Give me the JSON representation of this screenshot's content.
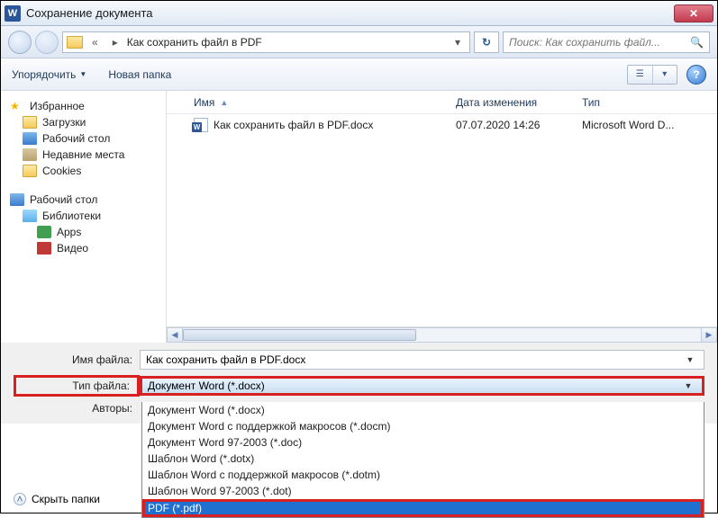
{
  "window": {
    "title": "Сохранение документа"
  },
  "nav": {
    "back_collapse": "«",
    "path_sep1": "▸",
    "path": "Как сохранить файл в PDF",
    "dropdown_glyph": "▾",
    "refresh_glyph": "↻",
    "search_placeholder": "Поиск: Как сохранить файл...",
    "search_icon_glyph": "🔍"
  },
  "toolbar": {
    "organize": "Упорядочить",
    "new_folder": "Новая папка",
    "view_glyph": "☰",
    "view_drop": "▾",
    "help_glyph": "?"
  },
  "sidebar": {
    "favorites": "Избранное",
    "downloads": "Загрузки",
    "desktop": "Рабочий стол",
    "recent": "Недавние места",
    "cookies": "Cookies",
    "desktop2": "Рабочий стол",
    "libraries": "Библиотеки",
    "apps": "Apps",
    "video": "Видео"
  },
  "columns": {
    "name": "Имя",
    "date": "Дата изменения",
    "type": "Тип"
  },
  "files": [
    {
      "name": "Как сохранить файл в PDF.docx",
      "date": "07.07.2020 14:26",
      "type": "Microsoft Word D..."
    }
  ],
  "form": {
    "filename_label": "Имя файла:",
    "filename_value": "Как сохранить файл в PDF.docx",
    "filetype_label": "Тип файла:",
    "filetype_value": "Документ Word (*.docx)",
    "authors_label": "Авторы:"
  },
  "dropdown": {
    "items": [
      "Документ Word (*.docx)",
      "Документ Word с поддержкой макросов (*.docm)",
      "Документ Word 97-2003 (*.doc)",
      "Шаблон Word (*.dotx)",
      "Шаблон Word с поддержкой макросов (*.dotm)",
      "Шаблон Word 97-2003 (*.dot)",
      "PDF (*.pdf)"
    ]
  },
  "footer": {
    "hide_folders": "Скрыть папки",
    "chev": "˄"
  }
}
